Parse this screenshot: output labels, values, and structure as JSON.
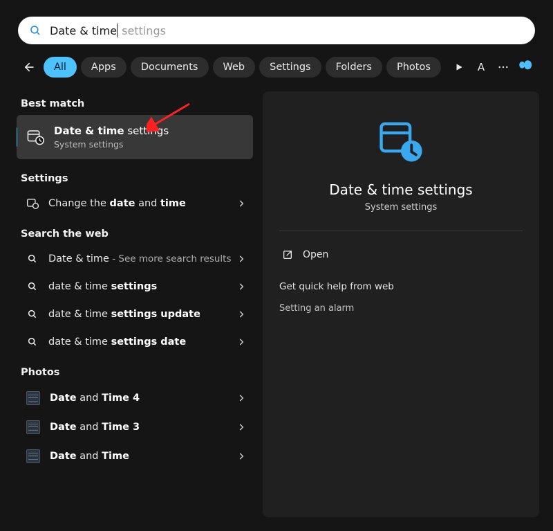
{
  "search": {
    "typed_text": "Date & time",
    "placeholder_suffix": " settings"
  },
  "filters": {
    "tabs": [
      "All",
      "Apps",
      "Documents",
      "Web",
      "Settings",
      "Folders",
      "Photos"
    ],
    "active_index": 0,
    "avatar_letter": "A"
  },
  "left": {
    "best_match_header": "Best match",
    "best_match": {
      "title_bold": "Date & time",
      "title_rest": " settings",
      "subtitle": "System settings"
    },
    "settings_header": "Settings",
    "settings_items": [
      {
        "pre": "Change the ",
        "b1": "date",
        "mid": " and ",
        "b2": "time"
      }
    ],
    "web_header": "Search the web",
    "web_items": [
      {
        "main": "Date & time",
        "suffix": " - See more search results"
      },
      {
        "pre": "date & time ",
        "b": "settings"
      },
      {
        "pre": "date & time ",
        "b": "settings update"
      },
      {
        "pre": "date & time ",
        "b": "settings date"
      }
    ],
    "photos_header": "Photos",
    "photos_items": [
      {
        "pre": "Date",
        "mid": " and ",
        "b": "Time 4"
      },
      {
        "pre": "Date",
        "mid": " and ",
        "b": "Time 3"
      },
      {
        "pre": "Date",
        "mid": " and ",
        "b": "Time"
      }
    ]
  },
  "right": {
    "title": "Date & time settings",
    "subtitle": "System settings",
    "open_label": "Open",
    "help_header": "Get quick help from web",
    "help_links": [
      "Setting an alarm"
    ]
  }
}
